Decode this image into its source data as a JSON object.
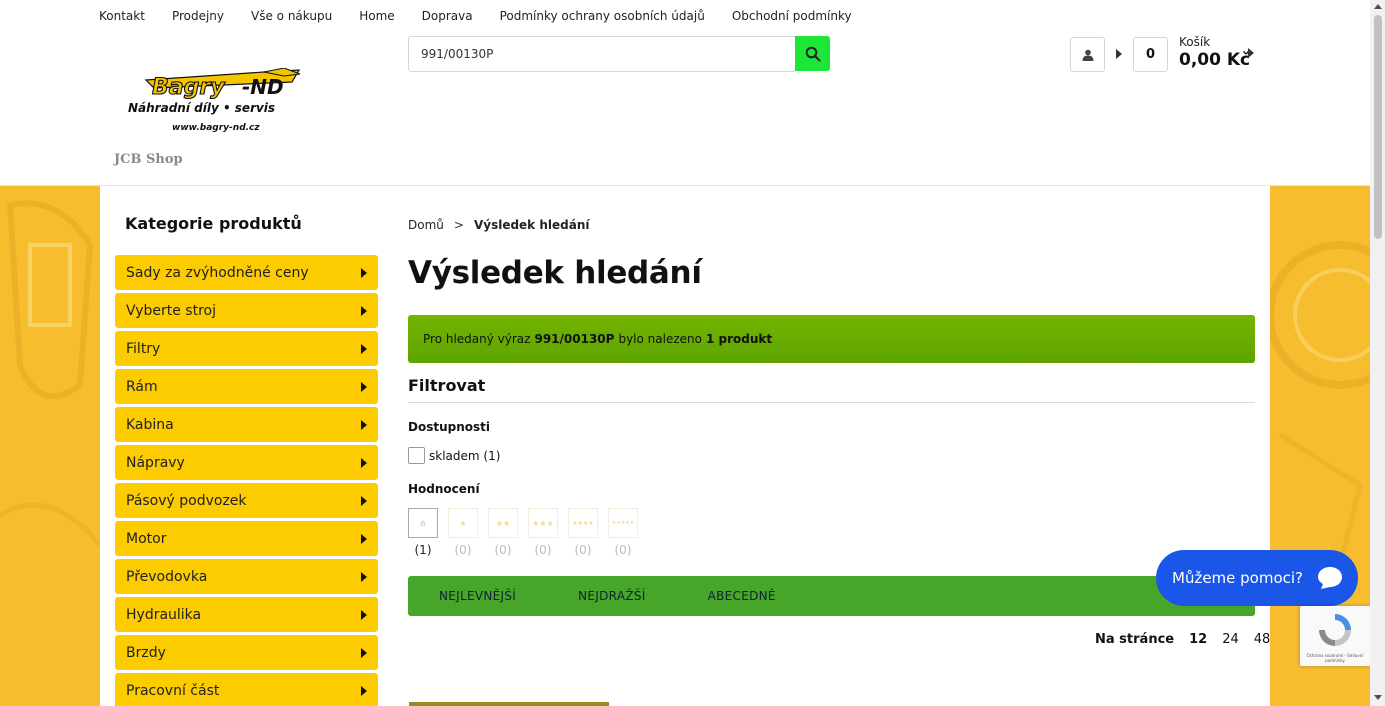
{
  "topnav": [
    "Kontakt",
    "Prodejny",
    "Vše o nákupu",
    "Home",
    "Doprava",
    "Podmínky ochrany osobních údajů",
    "Obchodní podmínky"
  ],
  "logo": {
    "brand": "Bagry-ND",
    "tagline": "Náhradní díly • servis",
    "url": "www.bagry-nd.cz"
  },
  "shop_name": "JCB Shop",
  "search": {
    "value": "991/00130P"
  },
  "cart": {
    "count": "0",
    "label": "Košík",
    "price": "0,00 Kč"
  },
  "categories": {
    "title": "Kategorie produktů",
    "items": [
      "Sady za zvýhodněné ceny",
      "Vyberte stroj",
      "Filtry",
      "Rám",
      "Kabina",
      "Nápravy",
      "Pásový podvozek",
      "Motor",
      "Převodovka",
      "Hydraulika",
      "Brzdy",
      "Pracovní část"
    ]
  },
  "breadcrumb": {
    "home": "Domů",
    "sep": ">",
    "current": "Výsledek hledání"
  },
  "page_title": "Výsledek hledání",
  "result_msg": {
    "prefix": "Pro hledaný výraz",
    "term": "991/00130P",
    "middle": "bylo nalezeno",
    "count": "1 produkt"
  },
  "filter": {
    "title": "Filtrovat",
    "availability_title": "Dostupnosti",
    "availability_option": "skladem (1)",
    "rating_title": "Hodnocení",
    "ratings": [
      {
        "stars": "☆",
        "count": "(1)"
      },
      {
        "stars": "★",
        "count": "(0)"
      },
      {
        "stars": "★★",
        "count": "(0)"
      },
      {
        "stars": "★★★",
        "count": "(0)"
      },
      {
        "stars": "★★★★",
        "count": "(0)"
      },
      {
        "stars": "★★★★★",
        "count": "(0)"
      }
    ]
  },
  "sort": [
    "NEJLEVNĚJŠÍ",
    "NEJDRAŽŠÍ",
    "ABECEDNĚ"
  ],
  "perpage": {
    "label": "Na stránce",
    "options": [
      "12",
      "24",
      "48"
    ]
  },
  "chat": {
    "label": "Můžeme pomoci?"
  },
  "recaptcha": {
    "text": "Ochrana soukromí - Smluvní podmínky"
  },
  "colors": {
    "category_bg": "#fccb00",
    "search_button": "#1ce637",
    "result_bar": "#6aad00",
    "sort_bar": "#47a52a",
    "chat": "#1a56e8",
    "side_bands": "#f6be2f"
  }
}
